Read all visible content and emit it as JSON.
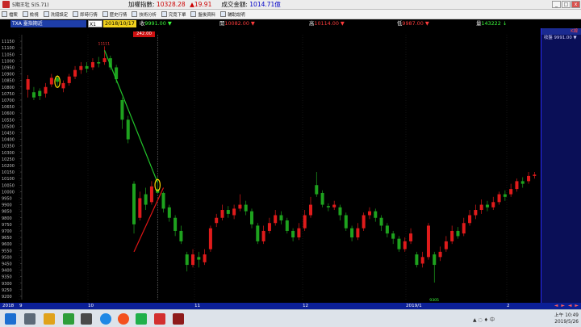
{
  "titlebar": {
    "app_title": "5期王牡 5(5.71)",
    "index_label": "加權指數:",
    "index_value": "10328.28",
    "index_change": "▲19.91",
    "volume_label": "成交金額:",
    "volume_value": "1014.71億"
  },
  "window_buttons": [
    "_",
    "□",
    "x"
  ],
  "toolbar": {
    "items": [
      "檔案",
      "檢視",
      "洗錢設定",
      "即時行情",
      "歷史行情",
      "技術分析",
      "究竟下單",
      "盤後資料",
      "輔助說明"
    ]
  },
  "infobar": {
    "code": "TXA 臺指期近",
    "period": "X1",
    "date": "2018/10/17",
    "close_label": "收",
    "close_value": "9991.00 ▼",
    "open_label": "開",
    "open_value": "10082.00 ▼",
    "high_label": "高",
    "high_value": "10114.00 ▼",
    "low_label": "低",
    "low_value": "9987.00 ▼",
    "volume_label": "量",
    "volume_value": "143222 ↓",
    "red_box": "242.00"
  },
  "right_panel": {
    "header": "K線",
    "rows": [
      "收盤 9991.00 ▼"
    ]
  },
  "chart_data": {
    "type": "candlestick",
    "y_ticks": [
      11150,
      11100,
      11050,
      11000,
      10950,
      10900,
      10850,
      10800,
      10750,
      10700,
      10650,
      10600,
      10550,
      10500,
      10450,
      10400,
      10350,
      10300,
      10250,
      10200,
      10150,
      10100,
      10050,
      10000,
      9950,
      9900,
      9850,
      9800,
      9750,
      9700,
      9650,
      9600,
      9550,
      9500,
      9450,
      9400,
      9350,
      9300,
      9250,
      9200
    ],
    "ylim": [
      9175,
      11175
    ],
    "x_tick_labels": [
      "2018",
      "9",
      "10",
      "11",
      "12",
      "2019/1",
      "2"
    ],
    "peak_label": "11111",
    "trough_label": "9305",
    "candles": [
      {
        "o": 10780,
        "c": 10860,
        "h": 10890,
        "l": 10720
      },
      {
        "o": 10760,
        "c": 10720,
        "h": 10800,
        "l": 10700
      },
      {
        "o": 10770,
        "c": 10730,
        "h": 10790,
        "l": 10700
      },
      {
        "o": 10750,
        "c": 10800,
        "h": 10830,
        "l": 10720
      },
      {
        "o": 10820,
        "c": 10870,
        "h": 10900,
        "l": 10800
      },
      {
        "o": 10870,
        "c": 10840,
        "h": 10890,
        "l": 10800
      },
      {
        "o": 10790,
        "c": 10830,
        "h": 10850,
        "l": 10760
      },
      {
        "o": 10830,
        "c": 10880,
        "h": 10900,
        "l": 10810
      },
      {
        "o": 10880,
        "c": 10930,
        "h": 10960,
        "l": 10860
      },
      {
        "o": 10930,
        "c": 10960,
        "h": 10990,
        "l": 10900
      },
      {
        "o": 10960,
        "c": 10940,
        "h": 10990,
        "l": 10910
      },
      {
        "o": 10950,
        "c": 10990,
        "h": 11020,
        "l": 10930
      },
      {
        "o": 10990,
        "c": 10980,
        "h": 11030,
        "l": 10950
      },
      {
        "o": 10990,
        "c": 11020,
        "h": 11111,
        "l": 10970
      },
      {
        "o": 11020,
        "c": 10950,
        "h": 11040,
        "l": 10930
      },
      {
        "o": 10950,
        "c": 10860,
        "h": 10970,
        "l": 10830
      },
      {
        "o": 10700,
        "c": 10550,
        "h": 10720,
        "l": 10480
      },
      {
        "o": 10550,
        "c": 10400,
        "h": 10580,
        "l": 10370
      },
      {
        "o": 10060,
        "c": 9750,
        "h": 10080,
        "l": 9680
      },
      {
        "o": 9800,
        "c": 9950,
        "h": 10000,
        "l": 9780
      },
      {
        "o": 9980,
        "c": 9900,
        "h": 10030,
        "l": 9860
      },
      {
        "o": 9920,
        "c": 10040,
        "h": 10080,
        "l": 9900
      },
      {
        "o": 10020,
        "c": 9991,
        "h": 10114,
        "l": 9987
      },
      {
        "o": 9990,
        "c": 9870,
        "h": 10000,
        "l": 9840
      },
      {
        "o": 9880,
        "c": 9800,
        "h": 9900,
        "l": 9770
      },
      {
        "o": 9800,
        "c": 9700,
        "h": 9820,
        "l": 9660
      },
      {
        "o": 9700,
        "c": 9620,
        "h": 9740,
        "l": 9600
      },
      {
        "o": 9520,
        "c": 9440,
        "h": 9540,
        "l": 9390
      },
      {
        "o": 9440,
        "c": 9520,
        "h": 9560,
        "l": 9420
      },
      {
        "o": 9500,
        "c": 9480,
        "h": 9540,
        "l": 9420
      },
      {
        "o": 9460,
        "c": 9520,
        "h": 9560,
        "l": 9440
      },
      {
        "o": 9560,
        "c": 9720,
        "h": 9740,
        "l": 9540
      },
      {
        "o": 9760,
        "c": 9800,
        "h": 9830,
        "l": 9730
      },
      {
        "o": 9800,
        "c": 9860,
        "h": 9900,
        "l": 9780
      },
      {
        "o": 9860,
        "c": 9830,
        "h": 9890,
        "l": 9800
      },
      {
        "o": 9820,
        "c": 9870,
        "h": 9900,
        "l": 9790
      },
      {
        "o": 9870,
        "c": 9900,
        "h": 9980,
        "l": 9850
      },
      {
        "o": 9900,
        "c": 9850,
        "h": 9930,
        "l": 9820
      },
      {
        "o": 9850,
        "c": 9750,
        "h": 9870,
        "l": 9720
      },
      {
        "o": 9740,
        "c": 9620,
        "h": 9760,
        "l": 9600
      },
      {
        "o": 9620,
        "c": 9700,
        "h": 9740,
        "l": 9600
      },
      {
        "o": 9700,
        "c": 9760,
        "h": 9800,
        "l": 9680
      },
      {
        "o": 9760,
        "c": 9820,
        "h": 9860,
        "l": 9740
      },
      {
        "o": 9820,
        "c": 9780,
        "h": 9850,
        "l": 9750
      },
      {
        "o": 9780,
        "c": 9700,
        "h": 9800,
        "l": 9680
      },
      {
        "o": 9700,
        "c": 9650,
        "h": 9720,
        "l": 9620
      },
      {
        "o": 9650,
        "c": 9720,
        "h": 9760,
        "l": 9630
      },
      {
        "o": 9720,
        "c": 9820,
        "h": 9860,
        "l": 9700
      },
      {
        "o": 9820,
        "c": 9900,
        "h": 9960,
        "l": 9800
      },
      {
        "o": 10050,
        "c": 9980,
        "h": 10150,
        "l": 9960
      },
      {
        "o": 9990,
        "c": 9900,
        "h": 10010,
        "l": 9880
      },
      {
        "o": 9890,
        "c": 9880,
        "h": 9910,
        "l": 9850
      },
      {
        "o": 9880,
        "c": 9900,
        "h": 9930,
        "l": 9860
      },
      {
        "o": 9880,
        "c": 9820,
        "h": 9900,
        "l": 9780
      },
      {
        "o": 9820,
        "c": 9720,
        "h": 9840,
        "l": 9700
      },
      {
        "o": 9720,
        "c": 9650,
        "h": 9740,
        "l": 9620
      },
      {
        "o": 9650,
        "c": 9720,
        "h": 9760,
        "l": 9630
      },
      {
        "o": 9720,
        "c": 9820,
        "h": 9840,
        "l": 9700
      },
      {
        "o": 9820,
        "c": 9850,
        "h": 9880,
        "l": 9790
      },
      {
        "o": 9850,
        "c": 9800,
        "h": 9870,
        "l": 9770
      },
      {
        "o": 9800,
        "c": 9740,
        "h": 9820,
        "l": 9700
      },
      {
        "o": 9740,
        "c": 9680,
        "h": 9760,
        "l": 9650
      },
      {
        "o": 9680,
        "c": 9640,
        "h": 9700,
        "l": 9600
      },
      {
        "o": 9640,
        "c": 9560,
        "h": 9660,
        "l": 9540
      },
      {
        "o": 9560,
        "c": 9620,
        "h": 9650,
        "l": 9540
      },
      {
        "o": 9620,
        "c": 9680,
        "h": 9720,
        "l": 9600
      },
      {
        "o": 9520,
        "c": 9440,
        "h": 9540,
        "l": 9420
      },
      {
        "o": 9450,
        "c": 9500,
        "h": 9540,
        "l": 9420
      },
      {
        "o": 9500,
        "c": 9740,
        "h": 9760,
        "l": 9480
      },
      {
        "o": 9520,
        "c": 9440,
        "h": 9540,
        "l": 9305
      },
      {
        "o": 9500,
        "c": 9540,
        "h": 9580,
        "l": 9470
      },
      {
        "o": 9560,
        "c": 9620,
        "h": 9660,
        "l": 9540
      },
      {
        "o": 9620,
        "c": 9700,
        "h": 9740,
        "l": 9600
      },
      {
        "o": 9700,
        "c": 9660,
        "h": 9730,
        "l": 9640
      },
      {
        "o": 9680,
        "c": 9760,
        "h": 9800,
        "l": 9660
      },
      {
        "o": 9760,
        "c": 9820,
        "h": 9860,
        "l": 9740
      },
      {
        "o": 9820,
        "c": 9860,
        "h": 9900,
        "l": 9790
      },
      {
        "o": 9860,
        "c": 9900,
        "h": 9940,
        "l": 9830
      },
      {
        "o": 9900,
        "c": 9880,
        "h": 9930,
        "l": 9850
      },
      {
        "o": 9880,
        "c": 9920,
        "h": 9960,
        "l": 9860
      },
      {
        "o": 9920,
        "c": 9980,
        "h": 10000,
        "l": 9900
      },
      {
        "o": 9980,
        "c": 9960,
        "h": 10010,
        "l": 9930
      },
      {
        "o": 9980,
        "c": 10020,
        "h": 10060,
        "l": 9960
      },
      {
        "o": 10020,
        "c": 10080,
        "h": 10100,
        "l": 10000
      },
      {
        "o": 10080,
        "c": 10060,
        "h": 10110,
        "l": 10030
      },
      {
        "o": 10080,
        "c": 10120,
        "h": 10150,
        "l": 10060
      },
      {
        "o": 10120,
        "c": 10130,
        "h": 10150,
        "l": 10100
      }
    ],
    "markers": [
      {
        "type": "ellipse",
        "candle": 5,
        "price": 10840,
        "color": "#ffd400"
      },
      {
        "type": "ellipse",
        "candle": 22,
        "price": 10050,
        "color": "#ffd400"
      }
    ],
    "trend_lines": [
      {
        "color": "#22c42a",
        "from": {
          "candle": 13,
          "price": 11080
        },
        "to": {
          "candle": 22,
          "price": 10070
        }
      },
      {
        "color": "#e01515",
        "from": {
          "candle": 18,
          "price": 9540
        },
        "to": {
          "candle": 23,
          "price": 10030
        }
      }
    ],
    "colors": {
      "up": "#e01b1b",
      "down": "#1ea21e",
      "grid": "#1a1a1a",
      "axis_text": "#bfbfbf"
    }
  },
  "xaxis": {
    "labels": [
      "2018",
      "9",
      "10",
      "11",
      "12",
      "2019/1",
      "2"
    ],
    "nav": "◄ ► ◄ ►"
  },
  "taskbar": {
    "time": "上午 10:49",
    "date": "2019/5/26",
    "tray": "▲ ◌ ♦ 中"
  }
}
